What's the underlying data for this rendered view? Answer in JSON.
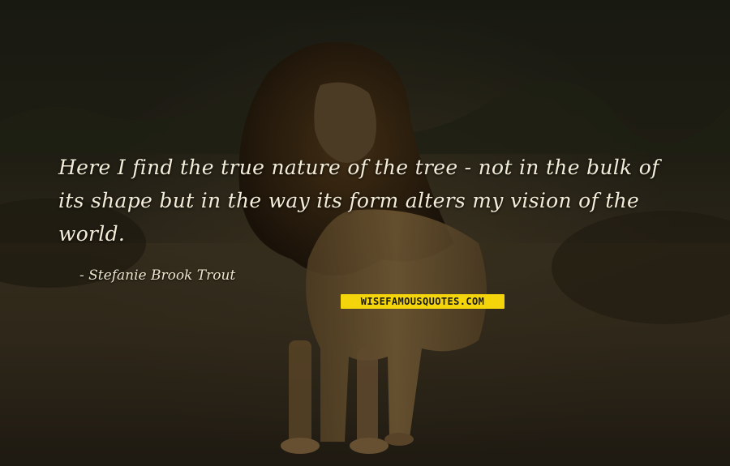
{
  "quote": {
    "text": "Here I find the true nature of the tree - not in the bulk of its shape but in the way its form alters my vision of the world.",
    "author": "Stefanie Brook Trout"
  },
  "watermark": {
    "text": "WISEFAMOUSQUOTES.COM",
    "background_color": "#f4d40a"
  },
  "background": {
    "subject": "lion standing in savanna grassland",
    "palette": [
      "#1b1a12",
      "#3a3322",
      "#8a6a3a"
    ]
  }
}
